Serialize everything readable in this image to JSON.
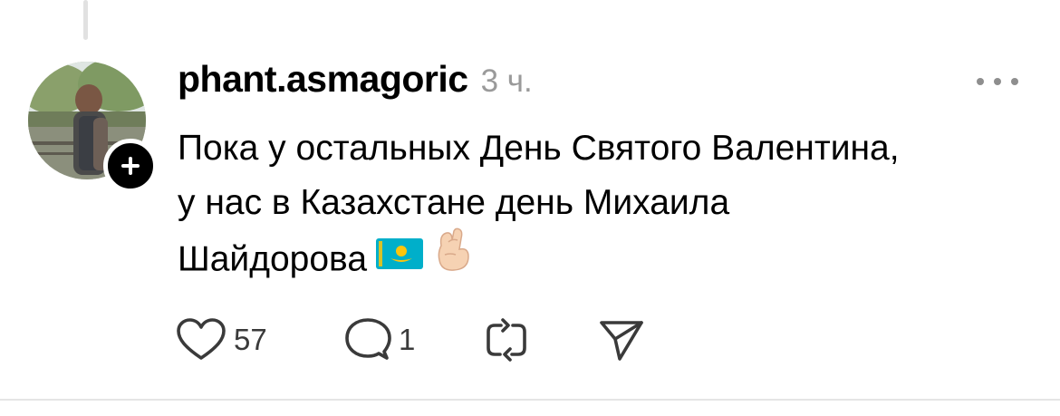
{
  "post": {
    "username": "phant.asmagoric",
    "timestamp": "3 ч.",
    "text_lines": [
      "Пока у остальных День Святого Валентина,",
      "у нас в Казахстане день Михаила",
      "Шайдорова"
    ],
    "emojis": [
      "kazakhstan-flag",
      "crossed-fingers"
    ]
  },
  "actions": {
    "likes": "57",
    "replies": "1"
  },
  "icons": {
    "avatar": "avatar",
    "follow": "plus-icon",
    "more": "more-options-icon",
    "like": "heart-icon",
    "reply": "comment-icon",
    "repost": "repost-icon",
    "share": "send-icon"
  },
  "colors": {
    "text": "#000000",
    "muted": "#9a9a9a",
    "icon": "#3a3a3a",
    "flag_blue": "#00afca",
    "flag_gold": "#fec50c"
  }
}
